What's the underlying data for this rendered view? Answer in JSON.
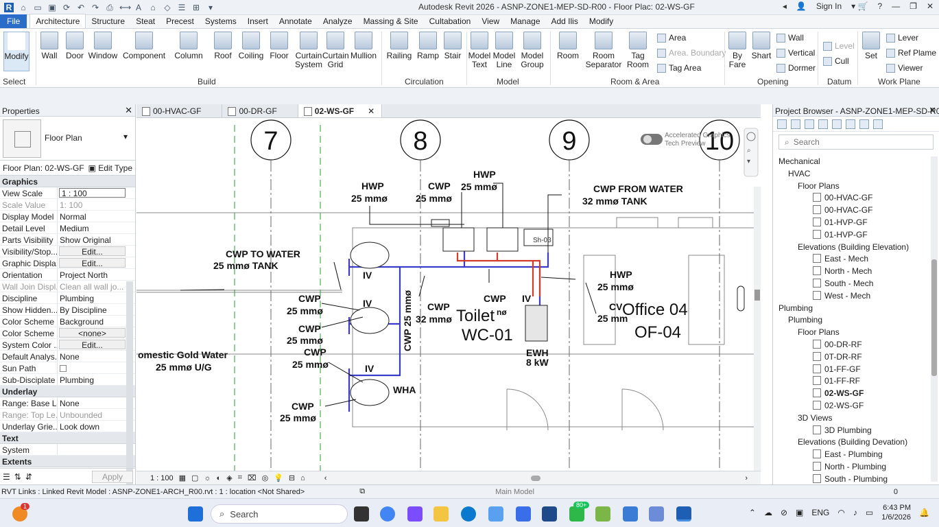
{
  "app": {
    "title": "Autodesk Revit 2026 - ASNP-ZONE1-MEP-SD-R00 - Floor Plac: 02-WS-GF",
    "sign_in": "Sign In",
    "help": "?"
  },
  "ribbon": {
    "tabs": [
      "File",
      "Architecture",
      "Structure",
      "Steat",
      "Precest",
      "Systems",
      "Insert",
      "Annotate",
      "Analyze",
      "Massing & Site",
      "Cultabation",
      "View",
      "Manage",
      "Add Ilis",
      "Modify"
    ],
    "buttons": {
      "modify": "Modify",
      "select": "Select",
      "wall": "Wall",
      "door": "Door",
      "window": "Window",
      "component": "Component",
      "column": "Column",
      "roof": "Roof",
      "ceiling": "Coiling",
      "floor": "Floor",
      "curtain_system": "Curtain System",
      "curtain_grid": "Curtain Grid",
      "mullion": "Mullion",
      "railing": "Railing",
      "ramp": "Ramp",
      "stair": "Stair",
      "model_text": "Model Text",
      "model_line": "Model Line",
      "model_group": "Model Group",
      "room": "Room",
      "room_separator": "Room Separator",
      "tag_room": "Tag Room",
      "area": "Area",
      "area_boundary": "Area. Boundary",
      "tag_area": "Tag  Area",
      "by_face": "By Fare",
      "shaft": "Shart",
      "wall_op": "Wall",
      "vertical": "Vertical",
      "dormer": "Dormer",
      "level": "Level",
      "grid": "Cull",
      "set": "Set",
      "lever": "Lever",
      "ref_plane": "Ref  Plame",
      "viewer": "Viewer"
    },
    "groups": {
      "build": "Build",
      "circulation": "Circulation",
      "model": "Model",
      "room_area": "Room & Area",
      "opening": "Opening",
      "datum": "Datum",
      "work_plane": "Work Plane"
    }
  },
  "properties": {
    "title": "Properties",
    "type_name": "Floor Plan",
    "selector": "Floor Plan: 02-WS-GF",
    "edit_type": "Edit Type",
    "cat_graphics": "Graphics",
    "rows": [
      {
        "k": "View Scale",
        "v": "1 : 100"
      },
      {
        "k": "Scale Value",
        "v": "1:  100"
      },
      {
        "k": "Display Model",
        "v": "Normal"
      },
      {
        "k": "Detail Level",
        "v": "Medium"
      },
      {
        "k": "Parts Visibility",
        "v": "Show Original"
      },
      {
        "k": "Visibility/Stop...",
        "v": "Edit..."
      },
      {
        "k": "Graphic Displa...",
        "v": "Edit..."
      },
      {
        "k": "Orientation",
        "v": "Project North"
      },
      {
        "k": "Wall Join Displ...",
        "v": "Clean all wall jo..."
      },
      {
        "k": "Discipline",
        "v": "Plumbing"
      },
      {
        "k": "Show Hidden...",
        "v": "By Discipline"
      },
      {
        "k": "Color Scheme ...",
        "v": "Background"
      },
      {
        "k": "Color Scheme",
        "v": "<none>"
      },
      {
        "k": "System Color ...",
        "v": "Edit..."
      },
      {
        "k": "Default Analys...",
        "v": "None"
      },
      {
        "k": "Sun Path",
        "v": ""
      },
      {
        "k": "Sub-Disciplate",
        "v": "Plumbing"
      }
    ],
    "cat_underlay": "Underlay",
    "underlay": [
      {
        "k": "Range: Base L...",
        "v": "None"
      },
      {
        "k": "Range: Top Le...",
        "v": "Unbounded"
      },
      {
        "k": "Underlay Grie...",
        "v": "Look down"
      }
    ],
    "cat_text": "Text",
    "text_row": "System",
    "cat_extents": "Extents",
    "apply": "Apply"
  },
  "view_tabs": [
    "00-HVAC-GF",
    "00-DR-GF",
    "02-WS-GF"
  ],
  "view_bar": {
    "scale": "1 : 100"
  },
  "canvas": {
    "grids": [
      "7",
      "8",
      "9",
      "10"
    ],
    "toggle": "Accelerated Graphics\nTech Preview",
    "labels": {
      "hwp1a": "HWP",
      "hwp1b": "25 mmø",
      "cwp1a": "CWP",
      "cwp1b": "25 mmø",
      "hwp2a": "HWP",
      "hwp2b": "25 mmø",
      "cwp_tank_a": "CWP  FROM WATER",
      "cwp_tank_b": "32 mmø  TANK",
      "to_tank_a": "CWP  TO WATER",
      "to_tank_b": "25 mmø  TANK",
      "iv1": "IV",
      "iv2": "IV",
      "iv3": "IV",
      "iv4": "IV",
      "cwp2a": "CWP",
      "cwp2b": "25 mmø",
      "cwp3a": "CWP",
      "cwp3b": "25 mmø",
      "cwp4a": "CWP",
      "cwp4b": "25 mmø",
      "cwp5a": "CWP",
      "cwp5b": "25 mmø",
      "cwp6a": "CWP",
      "cwp6b": "32 mmø",
      "cwp7": "CWP",
      "cwp7b": "nø",
      "vert": "CWP 25 mmø",
      "toilet": "Toilet",
      "wc": "WC-01",
      "wha": "WHA",
      "ewh": "EWH",
      "ewh_kw": "8 kW",
      "hwp3a": "HWP",
      "hwp3b": "25 mmø",
      "cv": "CV",
      "cv_b": "25 mm",
      "office": "Office 04",
      "of": "OF-04",
      "domestic_a": "omestic Gold Water",
      "domestic_b": "25 mmø U/G",
      "sh": "Sh-03"
    }
  },
  "project_browser": {
    "title": "Project Browser - ASNP-ZONE1-MEP-SD-R00",
    "search": "Search",
    "tree": [
      {
        "t": "Mechanical",
        "l": 0
      },
      {
        "t": "HVAC",
        "l": 1
      },
      {
        "t": "Floor Plans",
        "l": 2
      },
      {
        "t": "00-HVAC-GF",
        "l": 3,
        "leaf": true
      },
      {
        "t": "00-HVAC-GF",
        "l": 3,
        "leaf": true
      },
      {
        "t": "01-HVP-GF",
        "l": 3,
        "leaf": true
      },
      {
        "t": "01-HVP-GF",
        "l": 3,
        "leaf": true
      },
      {
        "t": "Elevations (Building Elevation)",
        "l": 2
      },
      {
        "t": "East - Mech",
        "l": 3,
        "leaf": true
      },
      {
        "t": "North - Mech",
        "l": 3,
        "leaf": true
      },
      {
        "t": "South - Mech",
        "l": 3,
        "leaf": true
      },
      {
        "t": "West - Mech",
        "l": 3,
        "leaf": true
      },
      {
        "t": "Plumbing",
        "l": 0
      },
      {
        "t": "Plumbing",
        "l": 1
      },
      {
        "t": "Floor Plans",
        "l": 2
      },
      {
        "t": "00-DR-RF",
        "l": 3,
        "leaf": true
      },
      {
        "t": "0T-DR-RF",
        "l": 3,
        "leaf": true
      },
      {
        "t": "01-FF-GF",
        "l": 3,
        "leaf": true
      },
      {
        "t": "01-FF-RF",
        "l": 3,
        "leaf": true
      },
      {
        "t": "02-WS-GF",
        "l": 3,
        "leaf": true,
        "sel": true
      },
      {
        "t": "02-WS-GF",
        "l": 3,
        "leaf": true
      },
      {
        "t": "3D Views",
        "l": 2
      },
      {
        "t": "3D Plumbing",
        "l": 3,
        "leaf": true
      },
      {
        "t": "Elevations (Building Devation)",
        "l": 2
      },
      {
        "t": "East - Plumbing",
        "l": 3,
        "leaf": true
      },
      {
        "t": "North - Plumbing",
        "l": 3,
        "leaf": true
      },
      {
        "t": "South - Plumbing",
        "l": 3,
        "leaf": true
      }
    ]
  },
  "status": {
    "text": "RVT Links : Linked Revit Model : ASNP-ZONE1-ARCH_R00.rvt : 1 : location <Not Shared>",
    "model": "Main Model",
    "filter": "0"
  },
  "taskbar": {
    "search": "Search",
    "lang": "ENG",
    "time": "6:43 PM",
    "date": "1/6/2026",
    "badge": "80+",
    "notif": "1"
  }
}
